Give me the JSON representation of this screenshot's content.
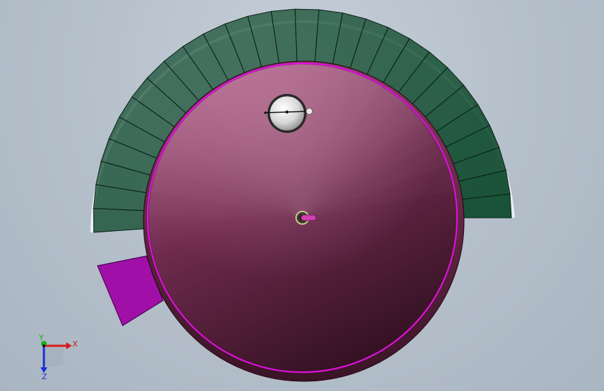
{
  "colors": {
    "background": "#b7c2cd",
    "segment_fill": "#0e4a2c",
    "segment_edge": "#0a1f14",
    "highlight_segment": "#a010a8",
    "disk_fill": "#6e2648",
    "disk_rim": "#e010e0",
    "x_axis": "#d81818",
    "y_axis": "#18b018",
    "z_axis": "#1830d8"
  },
  "segments": {
    "count": 28,
    "start_angle_deg": 90,
    "end_angle_deg": 354
  },
  "triad": {
    "x_label": "X",
    "y_label": "Y",
    "z_label": "Z"
  },
  "icons": {
    "sphere_knob": "sphere-knob-icon",
    "center_pin": "center-pin-icon",
    "axis_triad": "axis-triad-icon"
  }
}
